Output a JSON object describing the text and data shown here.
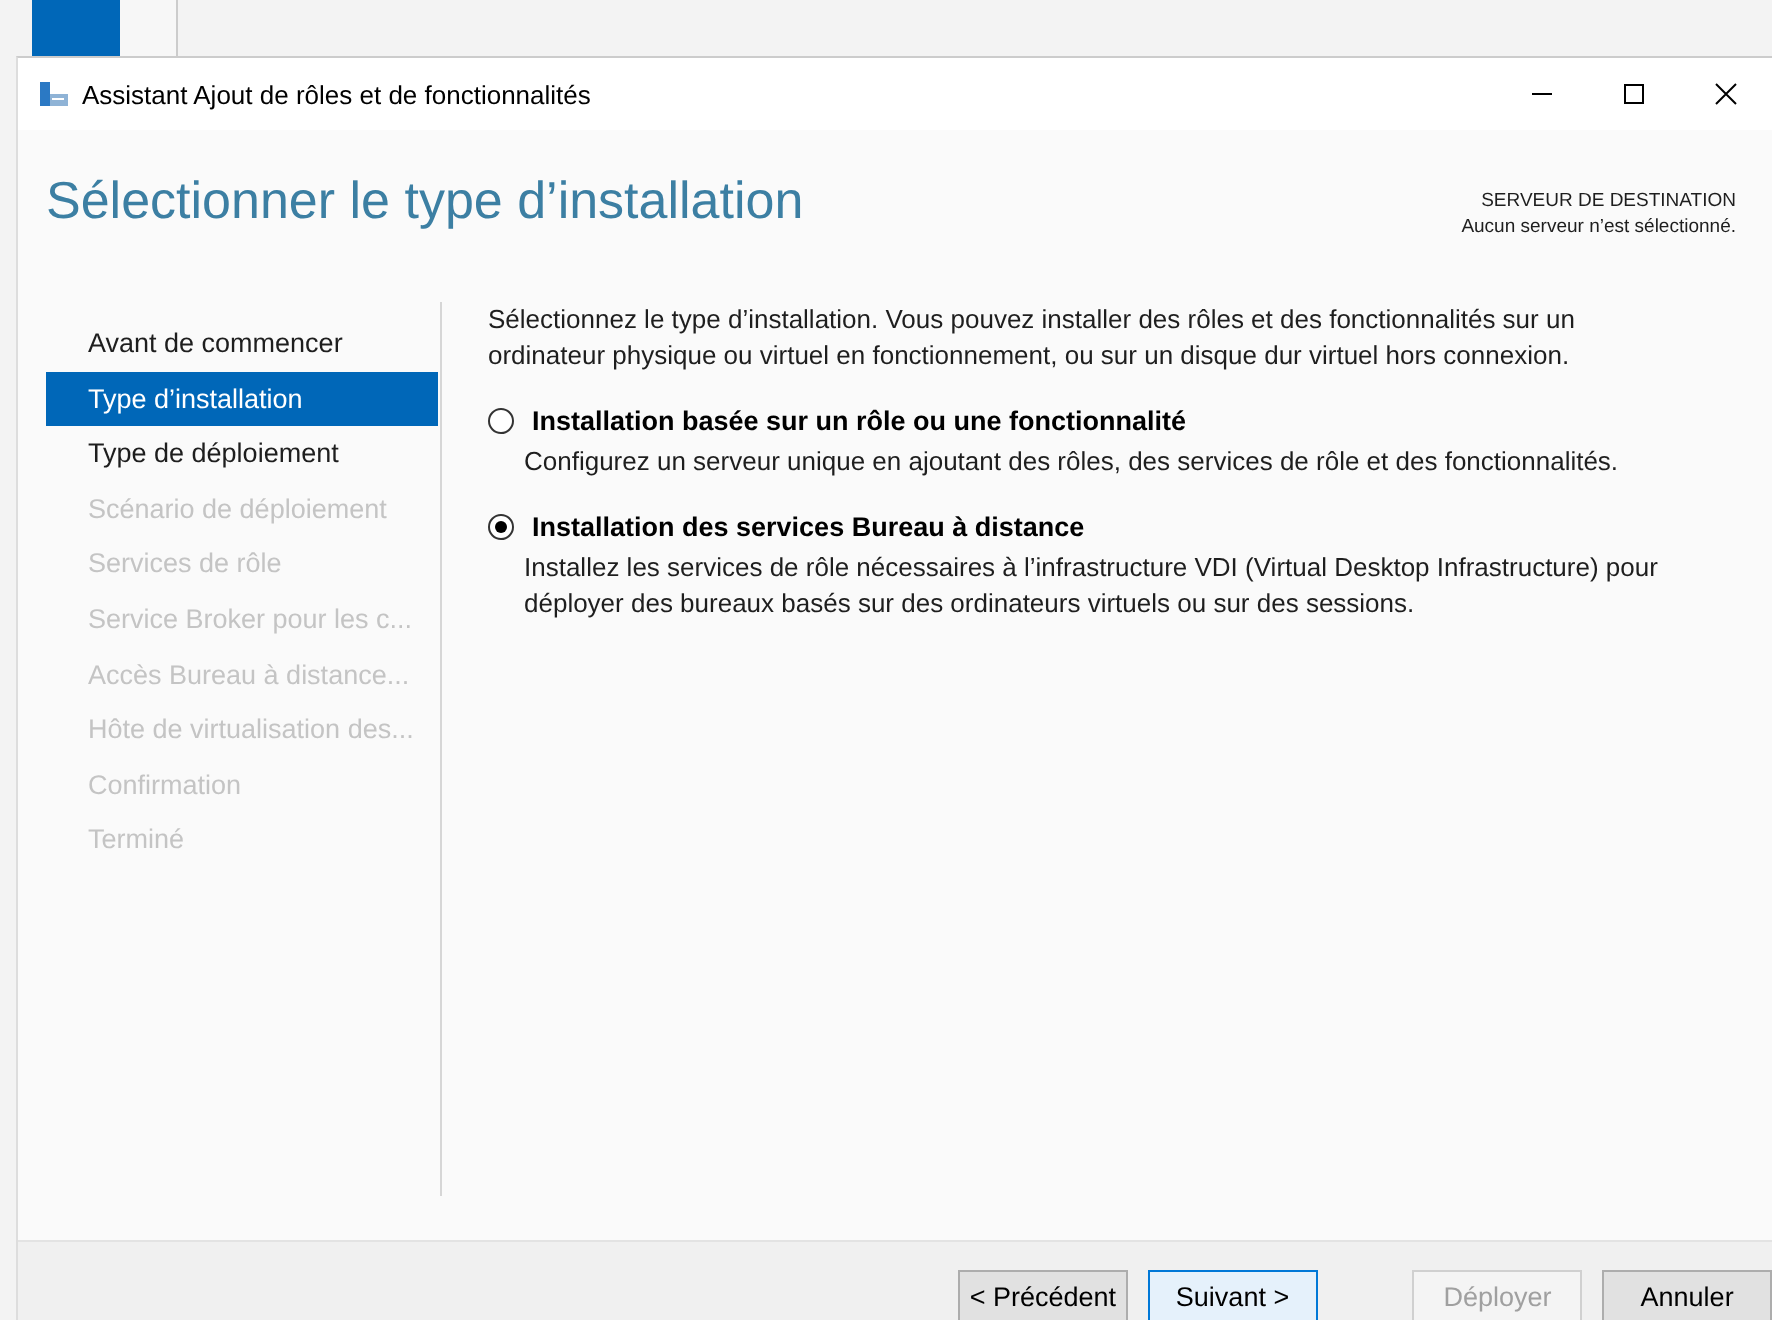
{
  "window": {
    "title": "Assistant Ajout de rôles et de fonctionnalités"
  },
  "header": {
    "title": "Sélectionner le type d’installation",
    "destination_label": "SERVEUR DE DESTINATION",
    "destination_value": "Aucun serveur n’est sélectionné."
  },
  "steps": [
    {
      "label": "Avant de commencer",
      "selected": false,
      "disabled": false
    },
    {
      "label": "Type d’installation",
      "selected": true,
      "disabled": false
    },
    {
      "label": "Type de déploiement",
      "selected": false,
      "disabled": false
    },
    {
      "label": "Scénario de déploiement",
      "selected": false,
      "disabled": true
    },
    {
      "label": "Services de rôle",
      "selected": false,
      "disabled": true
    },
    {
      "label": "Service Broker pour les c...",
      "selected": false,
      "disabled": true
    },
    {
      "label": "Accès Bureau à distance...",
      "selected": false,
      "disabled": true
    },
    {
      "label": "Hôte de virtualisation des...",
      "selected": false,
      "disabled": true
    },
    {
      "label": "Confirmation",
      "selected": false,
      "disabled": true
    },
    {
      "label": "Terminé",
      "selected": false,
      "disabled": true
    }
  ],
  "intro": "Sélectionnez le type d’installation. Vous pouvez installer des rôles et des fonctionnalités sur un ordinateur physique ou virtuel en fonctionnement, ou sur un disque dur virtuel hors connexion.",
  "options": [
    {
      "label": "Installation basée sur un rôle ou une fonctionnalité",
      "description": "Configurez un serveur unique en ajoutant des rôles, des services de rôle et des fonctionnalités.",
      "selected": false
    },
    {
      "label": "Installation des services Bureau à distance",
      "description": "Installez les services de rôle nécessaires à l’infrastructure VDI (Virtual Desktop Infrastructure) pour déployer des bureaux basés sur des ordinateurs virtuels ou sur des sessions.",
      "selected": true
    }
  ],
  "buttons": [
    {
      "label": "< Précédent",
      "disabled": false,
      "default": false
    },
    {
      "label": "Suivant >",
      "disabled": false,
      "default": true
    },
    {
      "label": "Déployer",
      "disabled": true,
      "default": false
    },
    {
      "label": "Annuler",
      "disabled": false,
      "default": false
    }
  ]
}
